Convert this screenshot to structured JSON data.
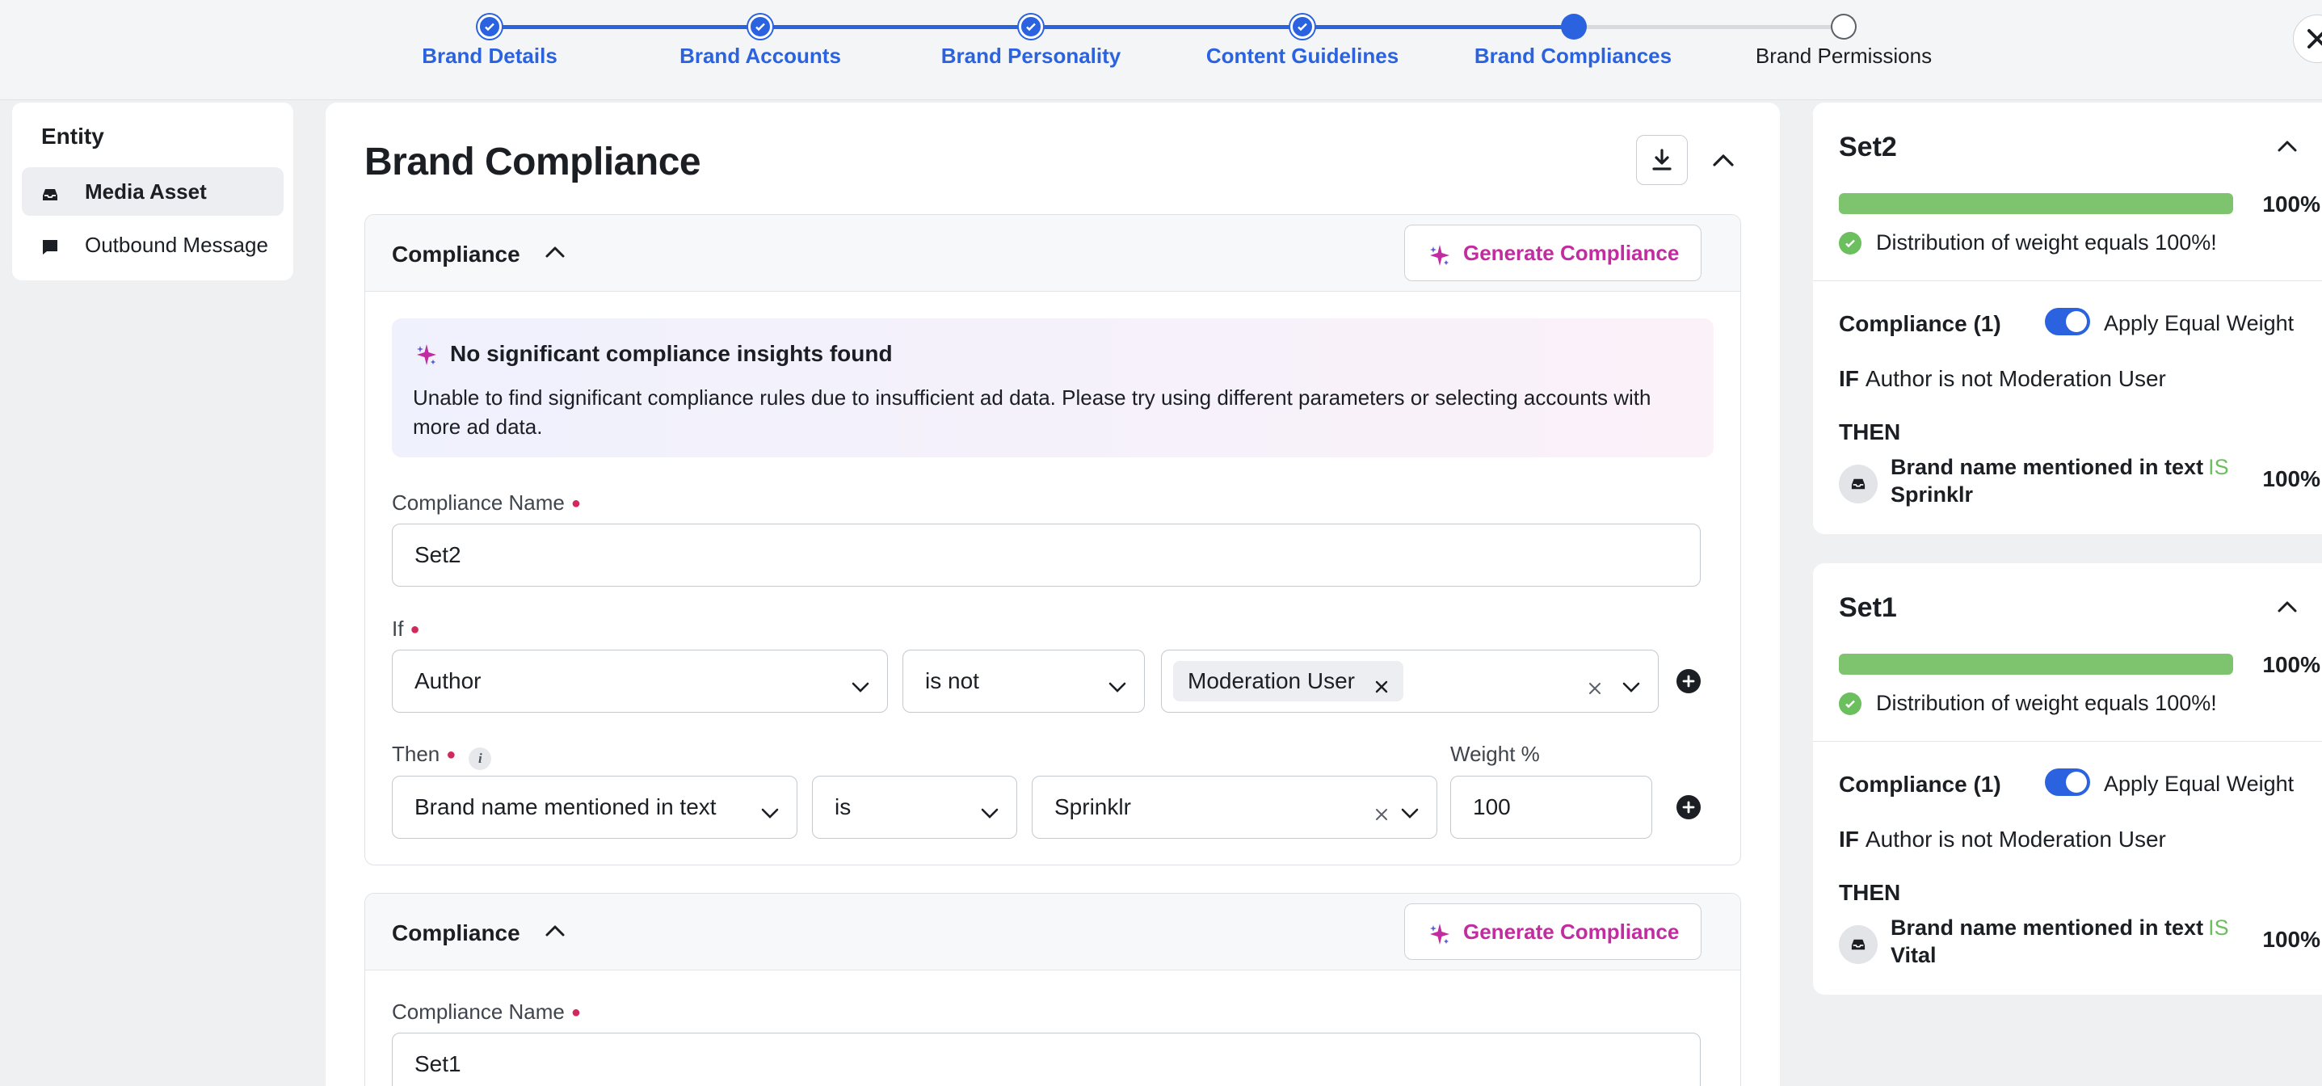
{
  "stepper": {
    "steps": [
      {
        "label": "Brand Details",
        "state": "done"
      },
      {
        "label": "Brand Accounts",
        "state": "done"
      },
      {
        "label": "Brand Personality",
        "state": "done"
      },
      {
        "label": "Content Guidelines",
        "state": "done"
      },
      {
        "label": "Brand Compliances",
        "state": "current"
      },
      {
        "label": "Brand Permissions",
        "state": "todo"
      }
    ],
    "accent": "#2a62e0"
  },
  "entity": {
    "title": "Entity",
    "items": [
      {
        "label": "Media Asset",
        "icon": "inbox-icon",
        "active": true
      },
      {
        "label": "Outbound Message",
        "icon": "message-icon",
        "active": false
      }
    ]
  },
  "main": {
    "title": "Brand Compliance",
    "compliances": [
      {
        "header": "Compliance",
        "generate_label": "Generate Compliance",
        "insight": {
          "title": "No significant compliance insights found",
          "text": "Unable to find significant compliance rules due to insufficient ad data. Please try using different parameters or selecting accounts with more ad data."
        },
        "name_label": "Compliance Name",
        "name_value": "Set2",
        "if_label": "If",
        "if_field": "Author",
        "if_operator": "is not",
        "if_value": "Moderation User",
        "then_label": "Then",
        "then_field": "Brand name mentioned in text",
        "then_operator": "is",
        "then_value": "Sprinklr",
        "weight_label": "Weight %",
        "weight_value": "100"
      },
      {
        "header": "Compliance",
        "generate_label": "Generate Compliance",
        "name_label": "Compliance Name",
        "name_value": "Set1"
      }
    ]
  },
  "summary": [
    {
      "title": "Set2",
      "progress": 100,
      "progress_label": "100%",
      "status": "Distribution of weight equals 100%!",
      "compliance_count": "Compliance (1)",
      "equal_weight_label": "Apply Equal Weight",
      "equal_weight_on": true,
      "if_keyword": "IF",
      "if_text": "Author is not Moderation User",
      "then_keyword": "THEN",
      "rule_field": "Brand name mentioned in text",
      "rule_operator": "IS",
      "rule_value": "Sprinklr",
      "rule_weight": "100%"
    },
    {
      "title": "Set1",
      "progress": 100,
      "progress_label": "100%",
      "status": "Distribution of weight equals 100%!",
      "compliance_count": "Compliance (1)",
      "equal_weight_label": "Apply Equal Weight",
      "equal_weight_on": true,
      "if_keyword": "IF",
      "if_text": "Author is not Moderation User",
      "then_keyword": "THEN",
      "rule_field": "Brand name mentioned in text",
      "rule_operator": "IS",
      "rule_value": "Vital",
      "rule_weight": "100%"
    }
  ]
}
